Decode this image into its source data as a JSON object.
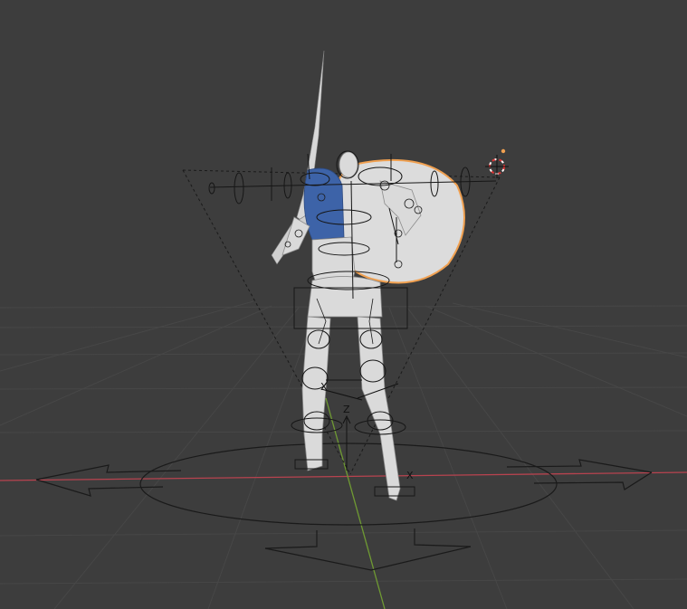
{
  "viewport": {
    "background": "#3d3d3d",
    "grid_color": "#484848",
    "x_axis_color": "#b8434f",
    "y_axis_color": "#6f9a33",
    "selection_outline_color": "#f0a050",
    "active_part_color": "#3d63a8",
    "mesh_color": "#dadada"
  },
  "gizmo": {
    "axis_labels": [
      "Z",
      "X",
      "X"
    ]
  },
  "icons": {
    "cursor": "3d-cursor-icon",
    "camera": "camera-frustum-icon",
    "root_control": "root-move-control-icon"
  }
}
